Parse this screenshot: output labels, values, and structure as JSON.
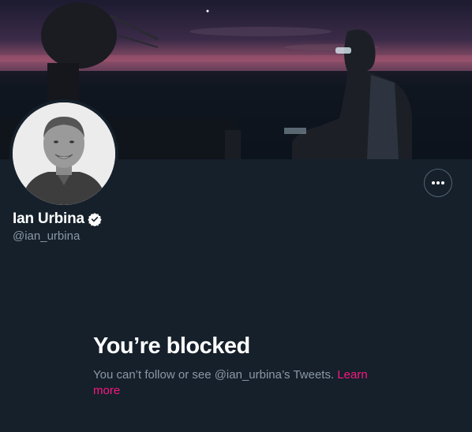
{
  "profile": {
    "display_name": "Ian Urbina",
    "handle": "@ian_urbina",
    "verified": true
  },
  "blocked": {
    "title": "You’re blocked",
    "message": "You can’t follow or see @ian_urbina’s Tweets.",
    "learn_more_label": "Learn more"
  },
  "icons": {
    "verified": "verified-badge-icon",
    "more": "more-options-icon"
  },
  "colors": {
    "background": "#15202b",
    "text_primary": "#ffffff",
    "text_secondary": "#8b98a5",
    "link": "#f91880",
    "border": "#536471"
  }
}
